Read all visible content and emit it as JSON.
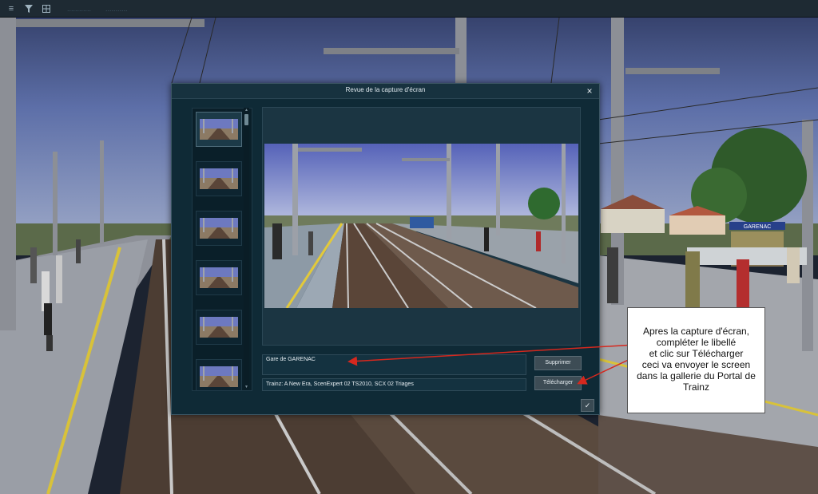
{
  "toolbar": {
    "items": [
      "menu-icon",
      "filter-icon",
      "grid-icon"
    ],
    "hint_1": "............",
    "hint_2": "..........."
  },
  "scene": {
    "station_sign": "GARENAC"
  },
  "dialog": {
    "title": "Revue de la capture d'écran",
    "close_glyph": "×",
    "label_value": "Gare de GARENAC",
    "description_value": "Trainz: A New Era, ScenExpert 02 TS2010, SCX 02 Triages",
    "delete_label": "Supprimer",
    "upload_label": "Télécharger",
    "ok_glyph": "✓",
    "thumbnail_count": 6,
    "selected_thumbnail": 0
  },
  "annotation": {
    "lines": [
      "Apres la capture d'écran,",
      "compléter le libellé",
      "et clic sur Télécharger",
      "ceci va envoyer le screen",
      "dans la gallerie du Portal de",
      "Trainz"
    ],
    "arrow_color": "#d6281e"
  },
  "colors": {
    "dialog_bg": "#0f2a36",
    "button_bg": "#3d4c55",
    "sky": "#5a6fa5"
  }
}
